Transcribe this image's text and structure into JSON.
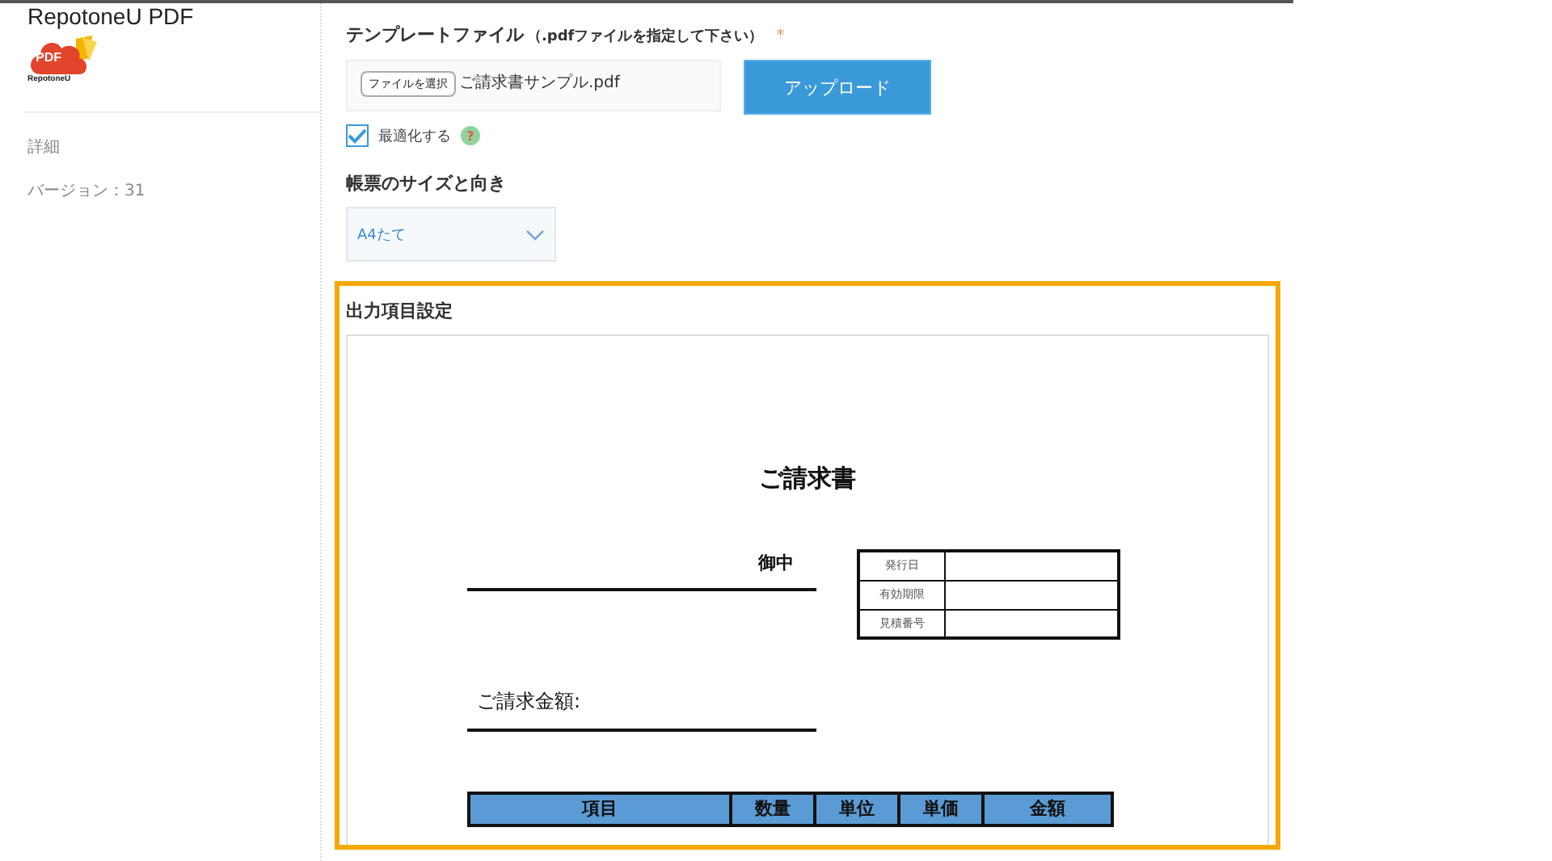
{
  "sidebar": {
    "app_title": "RepotoneU PDF",
    "logo_text": "PDF",
    "logo_caption": "RepotoneU",
    "items": [
      {
        "label": "詳細"
      },
      {
        "label": "バージョン：31"
      }
    ]
  },
  "template": {
    "label": "テンプレートファイル",
    "hint": "（.pdfファイルを指定して下さい）",
    "required_mark": "*",
    "file_button": "ファイルを選択",
    "file_name": "ご請求書サンプル.pdf",
    "upload_button": "アップロード",
    "optimize": {
      "label": "最適化する",
      "checked": true,
      "help": "?"
    }
  },
  "size": {
    "label": "帳票のサイズと向き",
    "value": "A4たて"
  },
  "output": {
    "label": "出力項目設定",
    "document": {
      "title": "ご請求書",
      "addressee_suffix": "御中",
      "info_rows": [
        {
          "label": "発行日"
        },
        {
          "label": "有効期限"
        },
        {
          "label": "見積番号"
        }
      ],
      "amount_label": "ご請求金額:",
      "columns": [
        "項目",
        "数量",
        "単位",
        "単価",
        "金額"
      ]
    }
  }
}
